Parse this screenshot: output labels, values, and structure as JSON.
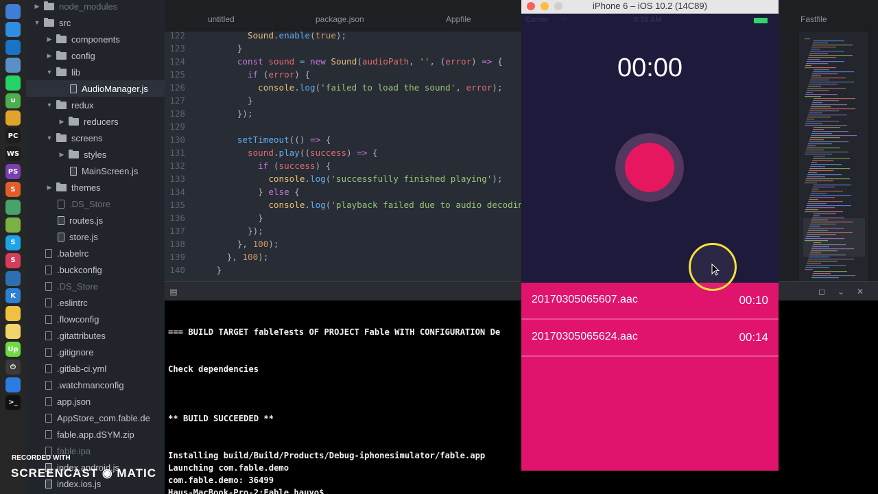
{
  "dock": {
    "icons": [
      {
        "name": "finder-icon",
        "color": "#3f7dd6",
        "glyph": ""
      },
      {
        "name": "safari-icon",
        "color": "#2f8ee0",
        "glyph": ""
      },
      {
        "name": "teamviewer-icon",
        "color": "#1a73c7",
        "glyph": ""
      },
      {
        "name": "preview-icon",
        "color": "#5a8fc8",
        "glyph": ""
      },
      {
        "name": "whatsapp-icon",
        "color": "#25d366",
        "glyph": ""
      },
      {
        "name": "utorrent-icon",
        "color": "#4cae4c",
        "glyph": "u"
      },
      {
        "name": "chrome-icon",
        "color": "#e0a42a",
        "glyph": ""
      },
      {
        "name": "pycharm-icon",
        "color": "#1d1d1d",
        "glyph": "PC"
      },
      {
        "name": "webstorm-icon",
        "color": "#1d1d1d",
        "glyph": "WS"
      },
      {
        "name": "phpstorm-icon",
        "color": "#7a3fb0",
        "glyph": "PS"
      },
      {
        "name": "sublime-icon",
        "color": "#e25d2c",
        "glyph": "S"
      },
      {
        "name": "atom-icon",
        "color": "#46a36a",
        "glyph": ""
      },
      {
        "name": "android-studio-icon",
        "color": "#7bb045",
        "glyph": ""
      },
      {
        "name": "skype-icon",
        "color": "#1fa3e8",
        "glyph": "S"
      },
      {
        "name": "slack-icon",
        "color": "#d63c5e",
        "glyph": "S"
      },
      {
        "name": "sourcetree-icon",
        "color": "#2c6fb3",
        "glyph": ""
      },
      {
        "name": "keynote-icon",
        "color": "#2e7fd6",
        "glyph": "K"
      },
      {
        "name": "cyberduck-icon",
        "color": "#f0c040",
        "glyph": ""
      },
      {
        "name": "numbers-icon",
        "color": "#f3d46a",
        "glyph": ""
      },
      {
        "name": "upwork-icon",
        "color": "#6fda44",
        "glyph": "Up"
      },
      {
        "name": "power-icon",
        "color": "#3a3a3a",
        "glyph": "⏻"
      },
      {
        "name": "appstore-icon",
        "color": "#2b7be0",
        "glyph": ""
      },
      {
        "name": "terminal-icon",
        "color": "#111111",
        "glyph": ">_"
      }
    ]
  },
  "tree": {
    "rows": [
      {
        "label": "node_modules",
        "type": "folder",
        "indent": 1,
        "open": false,
        "dim": true
      },
      {
        "label": "src",
        "type": "folder",
        "indent": 1,
        "open": true
      },
      {
        "label": "components",
        "type": "folder",
        "indent": 2,
        "open": false
      },
      {
        "label": "config",
        "type": "folder",
        "indent": 2,
        "open": false
      },
      {
        "label": "lib",
        "type": "folder",
        "indent": 2,
        "open": true
      },
      {
        "label": "AudioManager.js",
        "type": "js",
        "indent": 3,
        "selected": true
      },
      {
        "label": "redux",
        "type": "folder",
        "indent": 2,
        "open": true
      },
      {
        "label": "reducers",
        "type": "folder",
        "indent": 3,
        "open": false
      },
      {
        "label": "screens",
        "type": "folder",
        "indent": 2,
        "open": true
      },
      {
        "label": "styles",
        "type": "folder",
        "indent": 3,
        "open": false
      },
      {
        "label": "MainScreen.js",
        "type": "js",
        "indent": 3
      },
      {
        "label": "themes",
        "type": "folder",
        "indent": 2,
        "open": false
      },
      {
        "label": ".DS_Store",
        "type": "file",
        "indent": 2,
        "dim": true
      },
      {
        "label": "routes.js",
        "type": "js",
        "indent": 2
      },
      {
        "label": "store.js",
        "type": "js",
        "indent": 2
      },
      {
        "label": ".babelrc",
        "type": "file",
        "indent": 1
      },
      {
        "label": ".buckconfig",
        "type": "file",
        "indent": 1
      },
      {
        "label": ".DS_Store",
        "type": "file",
        "indent": 1,
        "dim": true
      },
      {
        "label": ".eslintrc",
        "type": "file",
        "indent": 1
      },
      {
        "label": ".flowconfig",
        "type": "file",
        "indent": 1
      },
      {
        "label": ".gitattributes",
        "type": "file",
        "indent": 1
      },
      {
        "label": ".gitignore",
        "type": "file",
        "indent": 1
      },
      {
        "label": ".gitlab-ci.yml",
        "type": "file",
        "indent": 1
      },
      {
        "label": ".watchmanconfig",
        "type": "file",
        "indent": 1
      },
      {
        "label": "app.json",
        "type": "file",
        "indent": 1
      },
      {
        "label": "AppStore_com.fable.de",
        "type": "file",
        "indent": 1
      },
      {
        "label": "fable.app.dSYM.zip",
        "type": "file",
        "indent": 1
      },
      {
        "label": "fable.ipa",
        "type": "file",
        "indent": 1,
        "dim": true
      },
      {
        "label": "index.android.js",
        "type": "js",
        "indent": 1
      },
      {
        "label": "index.ios.js",
        "type": "js",
        "indent": 1
      }
    ]
  },
  "tabs": [
    "untitled",
    "package.json",
    "Appfile",
    "Fastfile"
  ],
  "editor": {
    "lines": [
      {
        "n": "122",
        "html": "      <span class=\"c\">Sound</span>.<span class=\"f\">enable</span>(<span class=\"n\">true</span>);"
      },
      {
        "n": "123",
        "html": "    }"
      },
      {
        "n": "124",
        "html": "    <span class=\"k\">const</span> <span class=\"v\">sound</span> <span class=\"p\">=</span> <span class=\"k\">new</span> <span class=\"c\">Sound</span>(<span class=\"v\">audioPath</span>, <span class=\"s\">''</span>, (<span class=\"v\">error</span>) <span class=\"k\">=&gt;</span> {"
      },
      {
        "n": "125",
        "html": "      <span class=\"k\">if</span> (<span class=\"v\">error</span>) {"
      },
      {
        "n": "126",
        "html": "        <span class=\"c\">console</span>.<span class=\"f\">log</span>(<span class=\"s\">'failed to load the sound'</span>, <span class=\"v\">error</span>);"
      },
      {
        "n": "127",
        "html": "      }"
      },
      {
        "n": "128",
        "html": "    });"
      },
      {
        "n": "129",
        "html": ""
      },
      {
        "n": "130",
        "html": "    <span class=\"f\">setTimeout</span>(() <span class=\"k\">=&gt;</span> {"
      },
      {
        "n": "131",
        "html": "      <span class=\"v\">sound</span>.<span class=\"f\">play</span>((<span class=\"v\">success</span>) <span class=\"k\">=&gt;</span> {"
      },
      {
        "n": "132",
        "html": "        <span class=\"k\">if</span> (<span class=\"v\">success</span>) {"
      },
      {
        "n": "133",
        "html": "          <span class=\"c\">console</span>.<span class=\"f\">log</span>(<span class=\"s\">'successfully finished playing'</span>);"
      },
      {
        "n": "134",
        "html": "        } <span class=\"k\">else</span> {"
      },
      {
        "n": "135",
        "html": "          <span class=\"c\">console</span>.<span class=\"f\">log</span>(<span class=\"s\">'playback failed due to audio decoding errors'</span>);"
      },
      {
        "n": "136",
        "html": "        }"
      },
      {
        "n": "137",
        "html": "      });"
      },
      {
        "n": "138",
        "html": "    }, <span class=\"n\">100</span>);"
      },
      {
        "n": "139",
        "html": "  }, <span class=\"n\">100</span>);"
      },
      {
        "n": "140",
        "html": "}"
      }
    ]
  },
  "terminal": {
    "lines": [
      "=== BUILD TARGET fableTests OF PROJECT Fable WITH CONFIGURATION De",
      "Check dependencies",
      "** BUILD SUCCEEDED **",
      "Installing build/Build/Products/Debug-iphonesimulator/fable.app",
      "Launching com.fable.demo",
      "com.fable.demo: 36499",
      "Haus-MacBook-Pro-2:Fable hauyo$"
    ]
  },
  "simulator": {
    "title": "iPhone 6 – iOS 10.2 (14C89)",
    "carrier": "Carrier",
    "time": "6:56 AM",
    "timer": "00:00",
    "colors": {
      "background": "#1e1a3c",
      "accent": "#e0136d",
      "record": "#e6175e"
    },
    "recordings": [
      {
        "name": "20170305065607.aac",
        "duration": "00:10"
      },
      {
        "name": "20170305065624.aac",
        "duration": "00:14"
      }
    ]
  },
  "watermark": {
    "small": "RECORDED WITH",
    "big": "SCREENCAST ◉ MATIC"
  }
}
